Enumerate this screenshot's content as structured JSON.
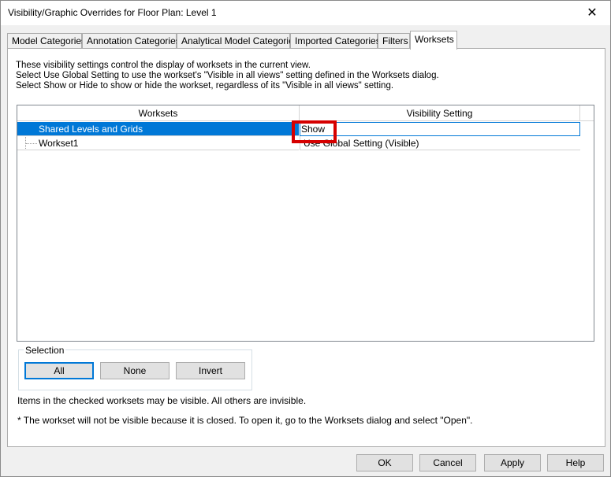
{
  "window": {
    "title": "Visibility/Graphic Overrides for Floor Plan: Level 1",
    "close_icon": "close-icon"
  },
  "tabs": [
    {
      "label": "Model Categories",
      "active": false
    },
    {
      "label": "Annotation Categories",
      "active": false
    },
    {
      "label": "Analytical Model Categories",
      "active": false
    },
    {
      "label": "Imported Categories",
      "active": false
    },
    {
      "label": "Filters",
      "active": false
    },
    {
      "label": "Worksets",
      "active": true
    }
  ],
  "description": {
    "line1": "These visibility settings control the display of worksets in the current view.",
    "line2": "Select Use Global Setting to use the workset's \"Visible in all views\" setting defined in the Worksets dialog.",
    "line3": "Select Show or Hide to show or hide the workset, regardless of its \"Visible in all views\" setting."
  },
  "grid": {
    "columns": [
      "Worksets",
      "Visibility Setting"
    ],
    "rows": [
      {
        "workset": "Shared Levels and Grids",
        "visibility": "Show",
        "selected": true
      },
      {
        "workset": "Workset1",
        "visibility": "Use Global Setting (Visible)",
        "selected": false
      }
    ]
  },
  "selection": {
    "label": "Selection",
    "all": "All",
    "none": "None",
    "invert": "Invert"
  },
  "notes": {
    "visible_note": "Items in the checked worksets may be visible.  All others are invisible.",
    "closed_note": "* The workset will not be visible because it is closed. To open it, go to the Worksets dialog and select \"Open\"."
  },
  "footer": {
    "ok": "OK",
    "cancel": "Cancel",
    "apply": "Apply",
    "help": "Help"
  },
  "colors": {
    "selection_blue": "#0078d7",
    "highlight_red": "#d60000"
  }
}
